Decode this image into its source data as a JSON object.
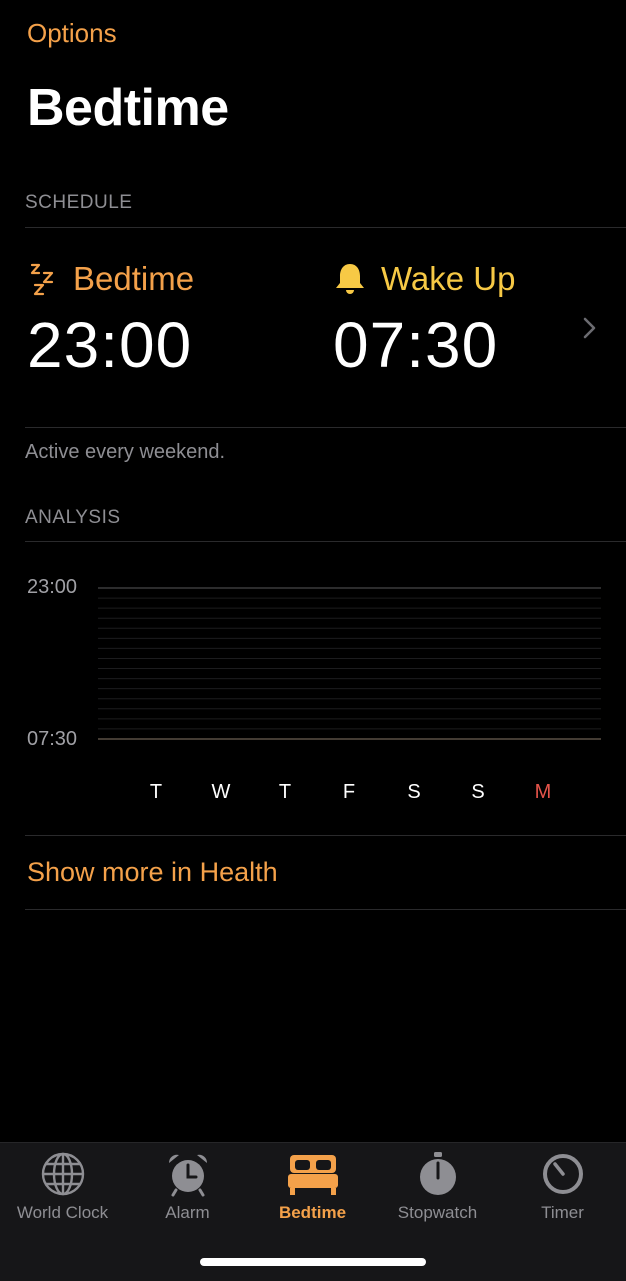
{
  "nav": {
    "options_label": "Options",
    "title": "Bedtime"
  },
  "schedule": {
    "section_label": "SCHEDULE",
    "bedtime": {
      "label": "Bedtime",
      "time": "23:00",
      "icon": "zzz-icon"
    },
    "wakeup": {
      "label": "Wake Up",
      "time": "07:30",
      "icon": "bell-icon"
    },
    "active_text": "Active every weekend."
  },
  "analysis": {
    "section_label": "ANALYSIS",
    "top_label": "23:00",
    "bottom_label": "07:30",
    "days": [
      "T",
      "W",
      "T",
      "F",
      "S",
      "S",
      "M"
    ],
    "today_index": 6
  },
  "health_link": "Show more in Health",
  "tabs": [
    {
      "label": "World Clock",
      "icon": "globe-icon"
    },
    {
      "label": "Alarm",
      "icon": "alarm-clock-icon"
    },
    {
      "label": "Bedtime",
      "icon": "bed-icon",
      "active": true
    },
    {
      "label": "Stopwatch",
      "icon": "stopwatch-icon"
    },
    {
      "label": "Timer",
      "icon": "timer-icon"
    }
  ],
  "colors": {
    "accent_orange": "#F4A14A",
    "wake_yellow": "#F7C945",
    "today_red": "#E5544A",
    "secondary_gray": "#8E8E93"
  }
}
